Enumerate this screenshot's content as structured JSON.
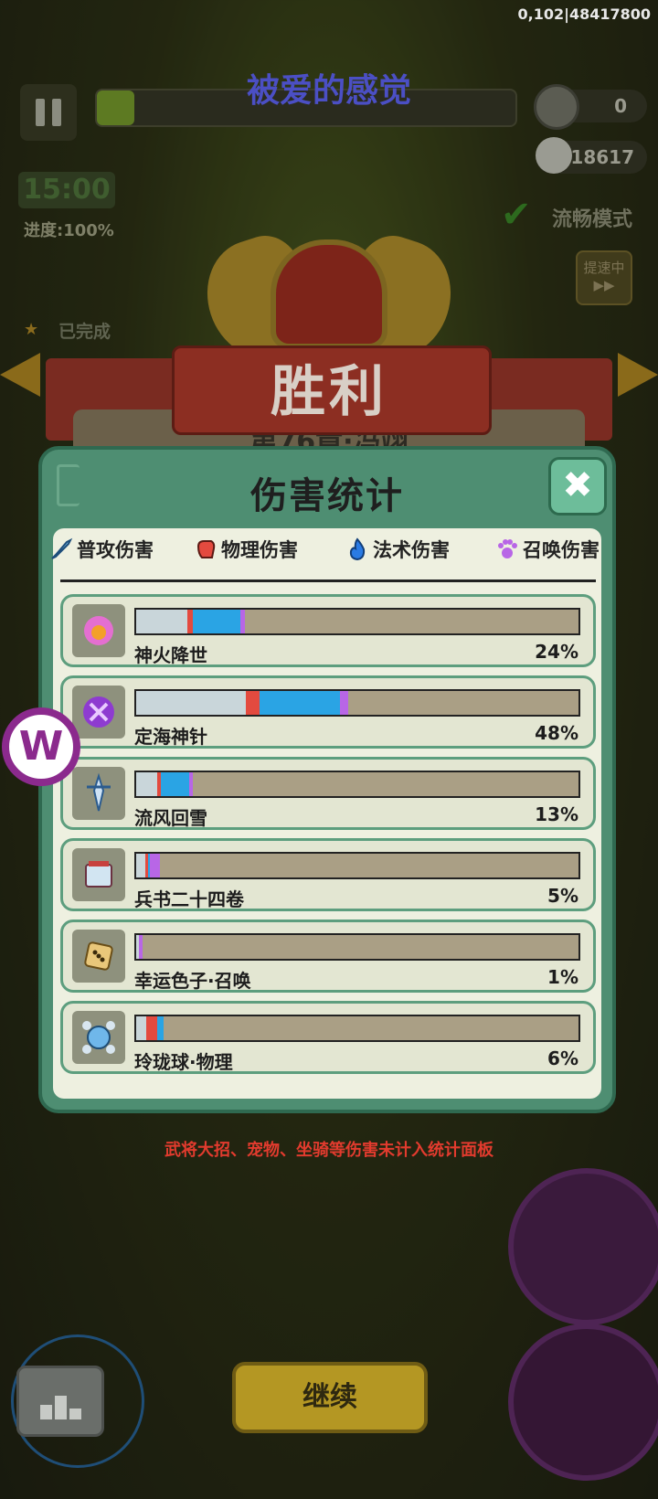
{
  "hud": {
    "user_id": "0,102|48417800",
    "song_title": "被爱的感觉",
    "progress_fraction": 0.09,
    "coins": "0",
    "kills": "18617",
    "timer": "15:00",
    "progress_text": "进度:100%",
    "mode_label": "流畅模式",
    "speed_label": "提速中",
    "completed_label": "已完成"
  },
  "victory": {
    "title": "胜利",
    "chapter": "第76章·冯翊"
  },
  "panel": {
    "title": "伤害统计",
    "close_icon": "close-icon",
    "legend": [
      {
        "label": "普攻伤害",
        "icon": "sword-icon",
        "color": "#2aa4e4"
      },
      {
        "label": "物理伤害",
        "icon": "fist-icon",
        "color": "#e34a3f"
      },
      {
        "label": "法术伤害",
        "icon": "flame-icon",
        "color": "#2a7be4"
      },
      {
        "label": "召唤伤害",
        "icon": "paw-icon",
        "color": "#b866e6"
      }
    ],
    "rows": [
      {
        "name": "神火降世",
        "percent": "24%",
        "icon": "fire-flower-icon",
        "segments": {
          "basic": 0.115,
          "phys": 0.013,
          "magic": 0.108,
          "summon": 0.01
        }
      },
      {
        "name": "定海神针",
        "percent": "48%",
        "icon": "purple-orb-icon",
        "segments": {
          "basic": 0.248,
          "phys": 0.03,
          "magic": 0.182,
          "summon": 0.02
        }
      },
      {
        "name": "流风回雪",
        "percent": "13%",
        "icon": "snow-blade-icon",
        "segments": {
          "basic": 0.048,
          "phys": 0.007,
          "magic": 0.065,
          "summon": 0.008
        }
      },
      {
        "name": "兵书二十四卷",
        "percent": "5%",
        "icon": "war-book-icon",
        "segments": {
          "basic": 0.02,
          "phys": 0.006,
          "magic": 0.006,
          "summon": 0.022
        }
      },
      {
        "name": "幸运色子·召唤",
        "percent": "1%",
        "icon": "dice-icon",
        "segments": {
          "basic": 0.006,
          "phys": 0.0,
          "magic": 0.0,
          "summon": 0.008
        }
      },
      {
        "name": "玲珑球·物理",
        "percent": "6%",
        "icon": "crystal-ball-icon",
        "segments": {
          "basic": 0.022,
          "phys": 0.025,
          "magic": 0.015,
          "summon": 0.0
        }
      }
    ]
  },
  "footnote": "武将大招、宠物、坐骑等伤害未计入统计面板",
  "continue_label": "继续"
}
